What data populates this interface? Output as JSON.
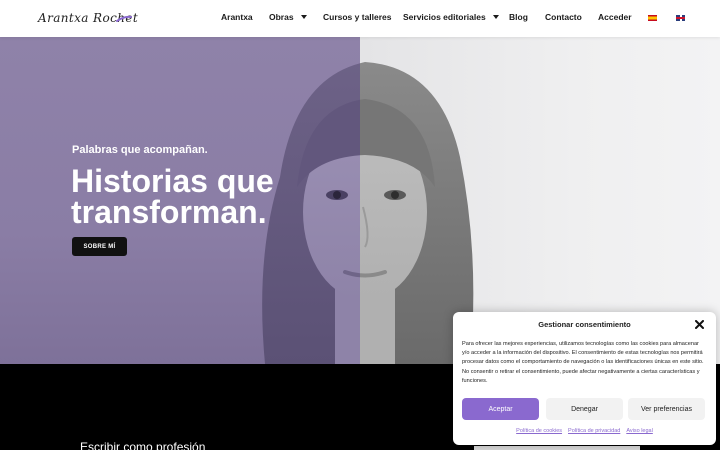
{
  "header": {
    "logo_text": "Arantxa Rochet",
    "nav": [
      {
        "label": "Arantxa",
        "has_dropdown": false
      },
      {
        "label": "Obras",
        "has_dropdown": true
      },
      {
        "label": "Cursos y talleres",
        "has_dropdown": false
      },
      {
        "label": "Servicios editoriales",
        "has_dropdown": true
      },
      {
        "label": "Blog",
        "has_dropdown": false
      },
      {
        "label": "Contacto",
        "has_dropdown": false
      },
      {
        "label": "Acceder",
        "has_dropdown": false
      }
    ],
    "languages": [
      "es-flag-icon",
      "en-flag-icon"
    ]
  },
  "hero": {
    "tagline": "Palabras que acompañan.",
    "title": "Historias que transforman.",
    "button_label": "SOBRE MÍ",
    "accent_color": "#8f82a9"
  },
  "section": {
    "heading": "Escribir como profesión"
  },
  "consent": {
    "title": "Gestionar consentimiento",
    "text": "Para ofrecer las mejores experiencias, utilizamos tecnologías como las cookies para almacenar y/o acceder a la información del dispositivo. El consentimiento de estas tecnologías nos permitirá procesar datos como el comportamiento de navegación o las identificaciones únicas en este sitio. No consentir o retirar el consentimiento, puede afectar negativamente a ciertas características y funciones.",
    "accept_label": "Aceptar",
    "deny_label": "Denegar",
    "prefs_label": "Ver preferencias",
    "links": [
      "Política de cookies",
      "Política de privacidad",
      "Aviso legal"
    ],
    "accent_color": "#8a69cf"
  }
}
